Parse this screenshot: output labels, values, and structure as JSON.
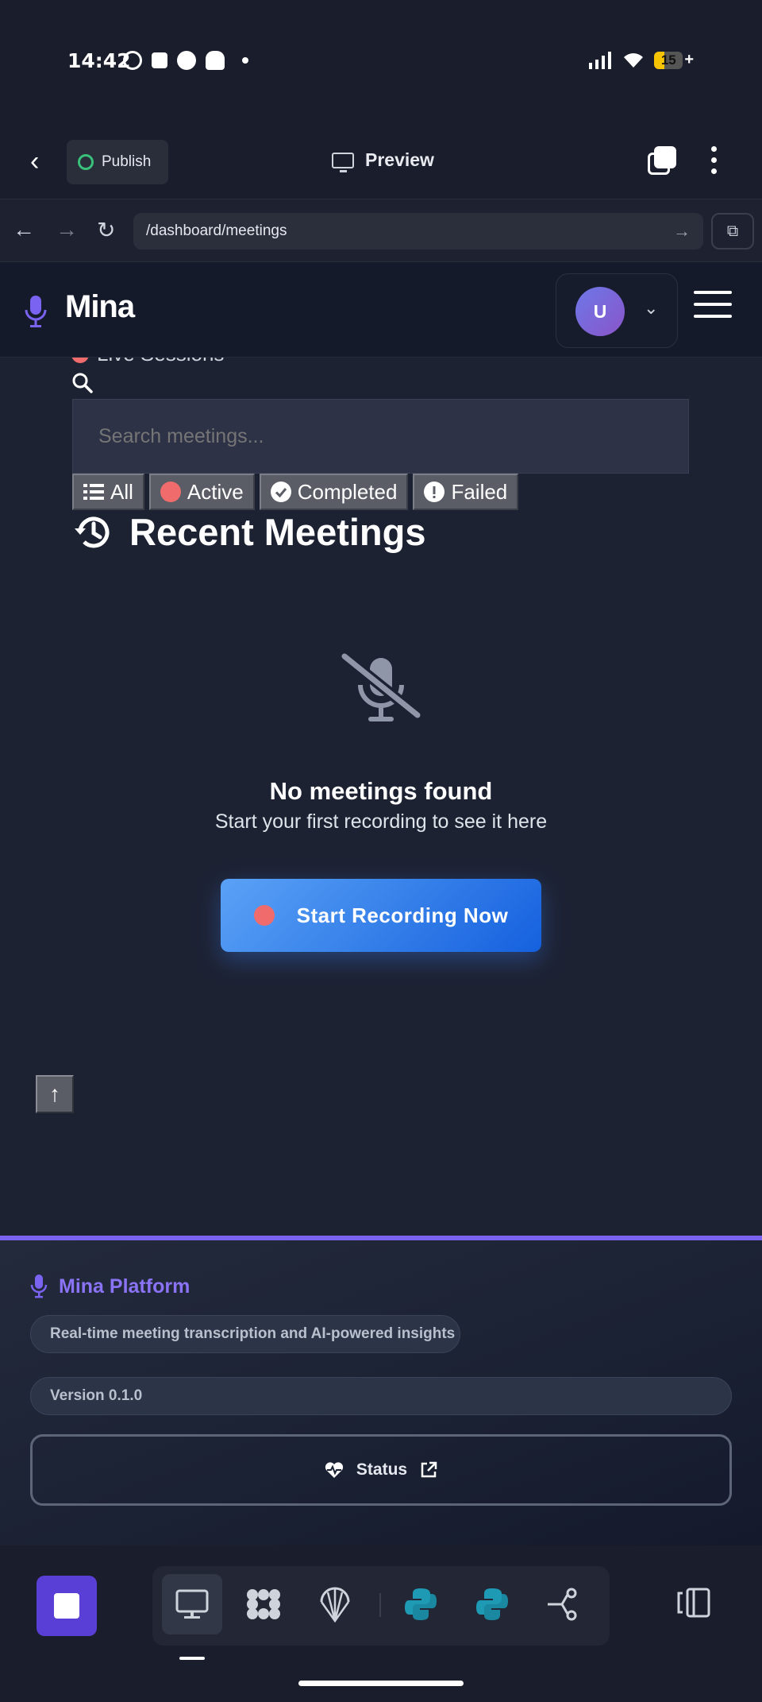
{
  "status_bar": {
    "time": "14:42",
    "battery": "15"
  },
  "editor_bar": {
    "publish_label": "Publish",
    "preview_label": "Preview"
  },
  "browser": {
    "url": "/dashboard/meetings"
  },
  "app_header": {
    "brand": "Mina",
    "avatar_initial": "U"
  },
  "main": {
    "peek_label": "Live Sessions",
    "search_placeholder": "Search meetings...",
    "filters": [
      {
        "label": "All",
        "icon": "list-icon"
      },
      {
        "label": "Active",
        "icon": "red-dot-icon",
        "color": "#f06c6c"
      },
      {
        "label": "Completed",
        "icon": "check-circle-icon"
      },
      {
        "label": "Failed",
        "icon": "exclamation-circle-icon"
      }
    ],
    "section_title": "Recent Meetings",
    "empty_title": "No meetings found",
    "empty_subtitle": "Start your first recording to see it here",
    "start_button": "Start Recording Now"
  },
  "footer": {
    "brand": "Mina Platform",
    "tagline": "Real-time meeting transcription and AI-powered insights",
    "version": "Version 0.1.0",
    "status_label": "Status"
  },
  "colors": {
    "accent": "#7a63f0",
    "primary_button": "#3b82f6",
    "record": "#f06c6c",
    "background": "#1d2233"
  }
}
